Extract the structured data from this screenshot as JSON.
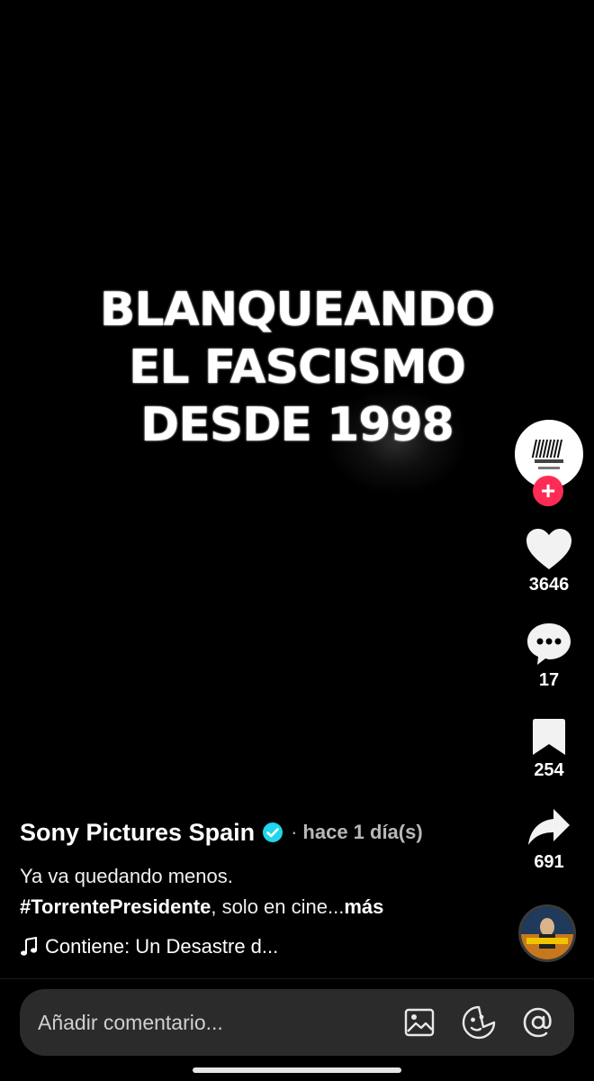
{
  "headline": {
    "line1": "BLANQUEANDO",
    "line2": "EL FASCISMO",
    "line3": "DESDE 1998"
  },
  "rail": {
    "avatar_icon": "sony-pictures-logo",
    "follow_icon": "plus-icon",
    "likes": "3646",
    "comments": "17",
    "saves": "254",
    "shares": "691"
  },
  "caption": {
    "author": "Sony Pictures Spain",
    "separator": "·",
    "time": "hace 1 día(s)",
    "text": "Ya va quedando menos.",
    "hashtag": "#TorrentePresidente",
    "text_after": ", solo en cine...",
    "more": "más",
    "music": "Contiene: Un Desastre d..."
  },
  "comment_bar": {
    "placeholder": "Añadir comentario..."
  },
  "colors": {
    "background": "#000000",
    "accent": "#fe2c55",
    "verified": "#20d5ec",
    "bar": "#2b2b2b"
  }
}
